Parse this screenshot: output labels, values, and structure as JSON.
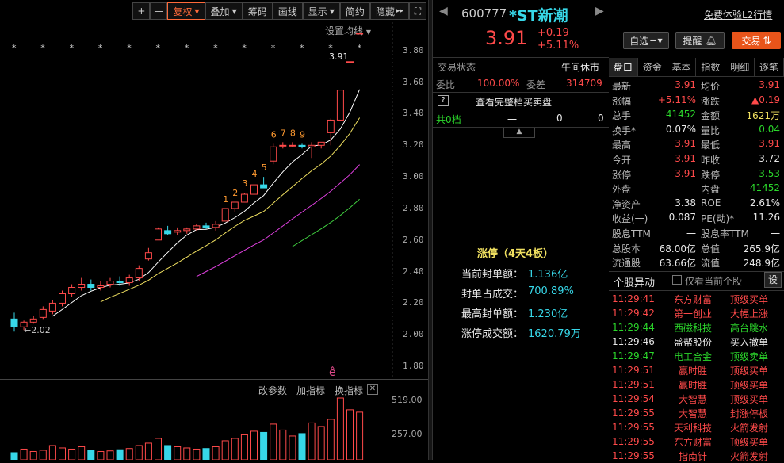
{
  "toolbar": {
    "buttons": [
      "+",
      "—",
      "复权",
      "叠加",
      "筹码",
      "画线",
      "显示",
      "简约",
      "隐藏"
    ],
    "collapse_icon": "▸▸",
    "fullscreen_icon": "⛶"
  },
  "chart": {
    "settings_label": "设置均线",
    "current_price_label": "3.91",
    "low_price_label": "←2.02",
    "price_ticks": [
      "3.80",
      "3.60",
      "3.40",
      "3.20",
      "3.00",
      "2.80",
      "2.60",
      "2.40",
      "2.20",
      "2.00",
      "1.80"
    ],
    "limit_counts": [
      "1",
      "2",
      "3",
      "4",
      "5",
      "6",
      "7",
      "8",
      "9"
    ],
    "volume_ticks": [
      "519.00",
      "257.00"
    ],
    "volume_menu": [
      "改参数",
      "加指标",
      "换指标"
    ],
    "event_marker": "ê"
  },
  "chart_data": {
    "type": "candlestick",
    "ylim": [
      1.72,
      3.98
    ],
    "candles": [
      [
        2.1,
        2.14,
        2.02,
        2.05
      ],
      [
        2.05,
        2.09,
        2.03,
        2.08
      ],
      [
        2.08,
        2.12,
        2.07,
        2.1
      ],
      [
        2.11,
        2.18,
        2.1,
        2.16
      ],
      [
        2.15,
        2.22,
        2.13,
        2.2
      ],
      [
        2.2,
        2.28,
        2.18,
        2.26
      ],
      [
        2.26,
        2.32,
        2.24,
        2.3
      ],
      [
        2.3,
        2.36,
        2.28,
        2.32
      ],
      [
        2.32,
        2.35,
        2.28,
        2.3
      ],
      [
        2.3,
        2.34,
        2.28,
        2.31
      ],
      [
        2.32,
        2.36,
        2.3,
        2.34
      ],
      [
        2.34,
        2.37,
        2.31,
        2.33
      ],
      [
        2.33,
        2.38,
        2.31,
        2.36
      ],
      [
        2.36,
        2.44,
        2.34,
        2.42
      ],
      [
        2.48,
        2.55,
        2.47,
        2.52
      ],
      [
        2.6,
        2.68,
        2.6,
        2.67
      ],
      [
        2.66,
        2.69,
        2.63,
        2.64
      ],
      [
        2.65,
        2.68,
        2.63,
        2.66
      ],
      [
        2.66,
        2.68,
        2.64,
        2.67
      ],
      [
        2.67,
        2.7,
        2.66,
        2.69
      ],
      [
        2.69,
        2.71,
        2.67,
        2.68
      ],
      [
        2.68,
        2.72,
        2.66,
        2.7
      ],
      [
        2.72,
        2.8,
        2.72,
        2.8
      ],
      [
        2.8,
        2.84,
        2.78,
        2.84
      ],
      [
        2.84,
        2.9,
        2.84,
        2.89
      ],
      [
        2.89,
        2.96,
        2.88,
        2.95
      ],
      [
        2.95,
        3.0,
        2.93,
        2.93
      ],
      [
        3.1,
        3.21,
        3.08,
        3.19
      ],
      [
        3.2,
        3.22,
        3.18,
        3.2
      ],
      [
        3.2,
        3.22,
        3.19,
        3.2
      ],
      [
        3.2,
        3.21,
        3.18,
        3.19
      ],
      [
        3.19,
        3.22,
        3.12,
        3.2
      ],
      [
        3.2,
        3.22,
        3.18,
        3.22
      ],
      [
        3.28,
        3.37,
        3.2,
        3.36
      ],
      [
        3.36,
        3.55,
        3.36,
        3.55
      ],
      [
        3.73,
        3.73,
        3.73,
        3.73
      ],
      [
        3.91,
        3.91,
        3.91,
        3.91
      ]
    ],
    "volumes": [
      60,
      90,
      70,
      80,
      120,
      100,
      90,
      110,
      80,
      70,
      75,
      85,
      95,
      120,
      140,
      180,
      120,
      110,
      100,
      90,
      95,
      110,
      160,
      180,
      210,
      240,
      230,
      300,
      250,
      200,
      220,
      310,
      280,
      340,
      519,
      420,
      400
    ]
  },
  "quote": {
    "code": "600777",
    "name": "*ST新潮",
    "price": "3.91",
    "change": "+0.19",
    "change_pct": "+5.11%",
    "l2_link": "免费体验L2行情",
    "watch_btn": "自选",
    "alert_btn": "提醒",
    "trade_btn": "交易",
    "status_label": "交易状态",
    "status_value": "午间休市",
    "wb_label": "委比",
    "wb_value": "100.00%",
    "wc_label": "委差",
    "wc_value": "314709",
    "order_link": "查看完整档买卖盘",
    "total_label": "共0档",
    "dash": "一",
    "zero1": "0",
    "zero2": "0",
    "limit_title": "涨停（4天4板）",
    "limit_rows": [
      [
        "当前封单额：",
        "1.136亿"
      ],
      [
        "封单占成交：",
        "700.89%"
      ],
      [
        "最高封单额：",
        "1.230亿"
      ],
      [
        "涨停成交额：",
        "1620.79万"
      ]
    ]
  },
  "detail": {
    "tabs": [
      "盘口",
      "资金",
      "基本",
      "指数",
      "明细",
      "逐笔"
    ],
    "rows": [
      [
        "最新",
        "3.91",
        "均价",
        "3.91"
      ],
      [
        "涨幅",
        "+5.11%",
        "涨跌",
        "▲0.19"
      ],
      [
        "总手",
        "41452",
        "金额",
        "1621万"
      ],
      [
        "换手*",
        "0.07%",
        "量比",
        "0.04"
      ],
      [
        "最高",
        "3.91",
        "最低",
        "3.91"
      ],
      [
        "今开",
        "3.91",
        "昨收",
        "3.72"
      ],
      [
        "涨停",
        "3.91",
        "跌停",
        "3.53"
      ],
      [
        "外盘",
        "一",
        "内盘",
        "41452"
      ],
      [
        "净资产",
        "3.38",
        "ROE",
        "2.61%"
      ],
      [
        "收益(一)",
        "0.087",
        "PE(动)*",
        "11.26"
      ],
      [
        "股息TTM",
        "一",
        "股息率TTM",
        "一"
      ],
      [
        "总股本",
        "68.00亿",
        "总值",
        "265.9亿"
      ],
      [
        "流通股",
        "63.66亿",
        "流值",
        "248.9亿"
      ]
    ],
    "anomaly_title": "个股异动",
    "anomaly_check": "仅看当前个股",
    "anomaly_btn": "设",
    "anomalies": [
      [
        "11:29:41",
        "东方财富",
        "顶级买单"
      ],
      [
        "11:29:42",
        "第一创业",
        "大幅上涨"
      ],
      [
        "11:29:44",
        "西磁科技",
        "高台跳水"
      ],
      [
        "11:29:46",
        "盛帮股份",
        "买入撤单"
      ],
      [
        "11:29:47",
        "电工合金",
        "顶级卖单"
      ],
      [
        "11:29:51",
        "赢时胜",
        "顶级买单"
      ],
      [
        "11:29:51",
        "赢时胜",
        "顶级买单"
      ],
      [
        "11:29:54",
        "大智慧",
        "顶级买单"
      ],
      [
        "11:29:55",
        "大智慧",
        "封涨停板"
      ],
      [
        "11:29:55",
        "天利科技",
        "火箭发射"
      ],
      [
        "11:29:55",
        "东方财富",
        "顶级买单"
      ],
      [
        "11:29:55",
        "指南针",
        "火箭发射"
      ]
    ]
  }
}
